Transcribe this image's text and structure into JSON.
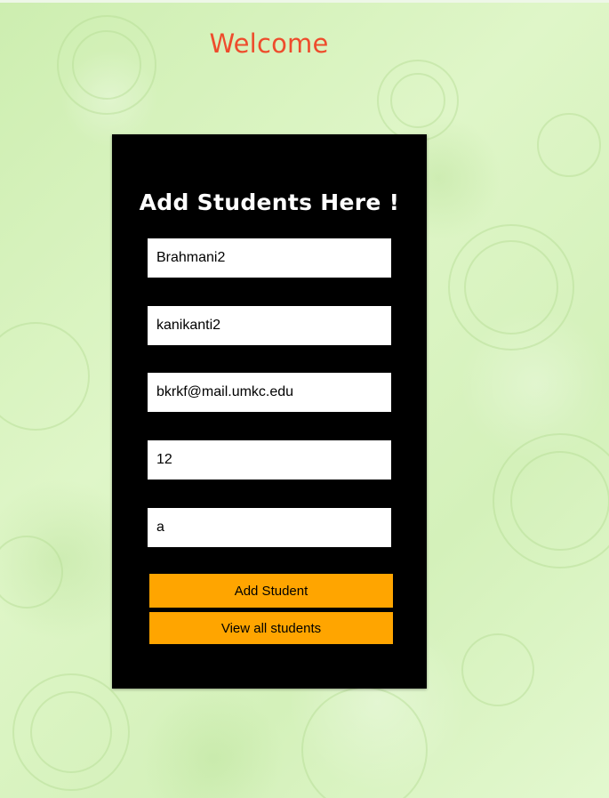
{
  "header": {
    "welcome_text": "Welcome"
  },
  "form": {
    "title": "Add Students Here !",
    "fields": [
      {
        "value": "Brahmani2"
      },
      {
        "value": "kanikanti2"
      },
      {
        "value": "bkrkf@mail.umkc.edu"
      },
      {
        "value": "12"
      },
      {
        "value": "a"
      }
    ],
    "add_button_label": "Add Student",
    "view_button_label": "View all students"
  },
  "colors": {
    "welcome": "#ee4c2c",
    "card_background": "#000000",
    "button_background": "#ffa500",
    "page_background": "#d8f3bd"
  }
}
